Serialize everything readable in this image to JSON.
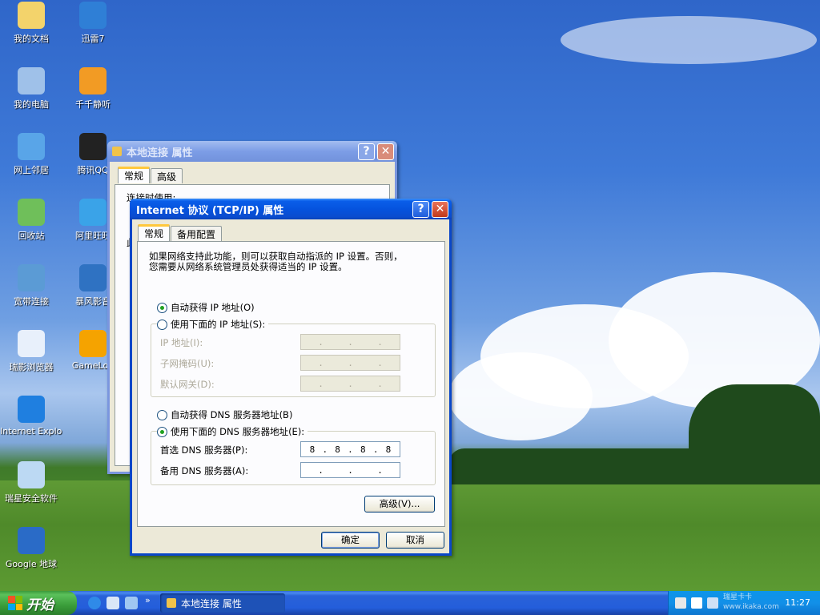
{
  "desktop": {
    "icons": [
      {
        "label": "我的文档",
        "icon": "my-documents-icon",
        "color": "#f3d36b"
      },
      {
        "label": "迅雷7",
        "icon": "thunder-icon",
        "color": "#2f7fd6"
      },
      {
        "label": "我的电脑",
        "icon": "my-computer-icon",
        "color": "#9fc1e9"
      },
      {
        "label": "千千静听",
        "icon": "ttplayer-icon",
        "color": "#f29b24"
      },
      {
        "label": "网上邻居",
        "icon": "network-places-icon",
        "color": "#59a5e8"
      },
      {
        "label": "腾讯QQ",
        "icon": "qq-icon",
        "color": "#222222"
      },
      {
        "label": "回收站",
        "icon": "recycle-bin-icon",
        "color": "#6fbf5a"
      },
      {
        "label": "阿里旺旺",
        "icon": "aliwangwang-icon",
        "color": "#3aa3e8"
      },
      {
        "label": "宽带连接",
        "icon": "broadband-icon",
        "color": "#5b9bd5"
      },
      {
        "label": "暴风影音",
        "icon": "baofeng-icon",
        "color": "#2f72c2"
      },
      {
        "label": "瑞影浏览器",
        "icon": "rising-browser-icon",
        "color": "#e8f0fb"
      },
      {
        "label": "GameLob",
        "icon": "gamelobby-icon",
        "color": "#f5a300"
      },
      {
        "label": "Internet Explorer",
        "icon": "internet-explorer-icon",
        "color": "#1f7fe0"
      },
      {
        "label": "瑞星安全软件",
        "icon": "rising-security-icon",
        "color": "#bcd9f3"
      },
      {
        "label": "Google 地球",
        "icon": "google-earth-icon",
        "color": "#2a6bc7"
      }
    ]
  },
  "back_window": {
    "title": "本地连接 属性",
    "tabs": [
      "常规",
      "高级"
    ],
    "partial_text": "连接时使用:",
    "partial_text2": "此"
  },
  "dialog": {
    "title": "Internet 协议 (TCP/IP) 属性",
    "tabs": [
      "常规",
      "备用配置"
    ],
    "description_line1": "如果网络支持此功能，则可以获取自动指派的 IP 设置。否则，",
    "description_line2": "您需要从网络系统管理员处获得适当的 IP 设置。",
    "ip_auto_label": "自动获得 IP 地址(O)",
    "ip_manual_label": "使用下面的 IP 地址(S):",
    "ip_address_label": "IP 地址(I):",
    "subnet_label": "子网掩码(U):",
    "gateway_label": "默认网关(D):",
    "dns_auto_label": "自动获得 DNS 服务器地址(B)",
    "dns_manual_label": "使用下面的 DNS 服务器地址(E):",
    "dns_pref_label": "首选 DNS 服务器(P):",
    "dns_alt_label": "备用 DNS 服务器(A):",
    "dns_pref_octets": [
      "8",
      "8",
      "8",
      "8"
    ],
    "advanced_label": "高级(V)...",
    "ok_label": "确定",
    "cancel_label": "取消",
    "help_glyph": "?",
    "close_glyph": "✕"
  },
  "taskbar": {
    "start_label": "开始",
    "task_button_label": "本地连接 属性",
    "clock": "11:27",
    "watermark": "瑞星卡卡 www.ikaka.com"
  }
}
